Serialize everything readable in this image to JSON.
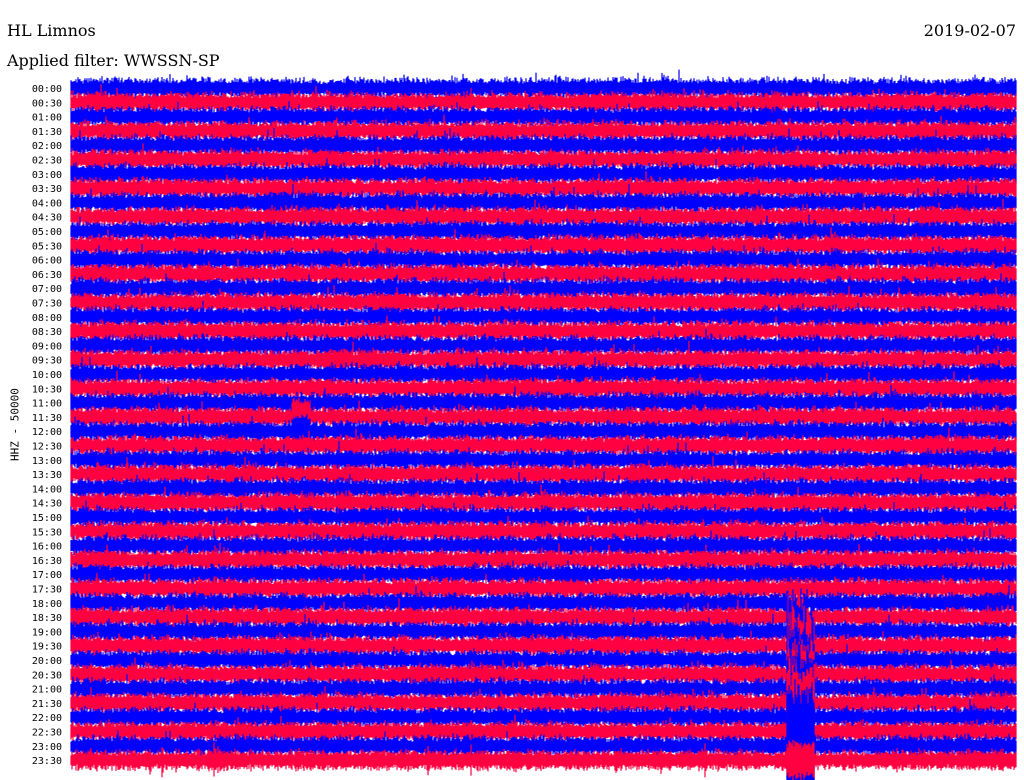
{
  "header": {
    "station": "HL Limnos",
    "date": "2019-02-07",
    "filter_label": "Applied filter:",
    "filter_value": "WWSSN-SP"
  },
  "chart_data": {
    "type": "line",
    "subtype": "helicorder",
    "title": "HL Limnos",
    "ylabel": "HHZ - 50000",
    "minutes_per_line": 30,
    "row_labels": [
      "00:00",
      "00:30",
      "01:00",
      "01:30",
      "02:00",
      "02:30",
      "03:00",
      "03:30",
      "04:00",
      "04:30",
      "05:00",
      "05:30",
      "06:00",
      "06:30",
      "07:00",
      "07:30",
      "08:00",
      "08:30",
      "09:00",
      "09:30",
      "10:00",
      "10:30",
      "11:00",
      "11:30",
      "12:00",
      "12:30",
      "13:00",
      "13:30",
      "14:00",
      "14:30",
      "15:00",
      "15:30",
      "16:00",
      "16:30",
      "17:00",
      "17:30",
      "18:00",
      "18:30",
      "19:00",
      "19:30",
      "20:00",
      "20:30",
      "21:00",
      "21:30",
      "22:00",
      "22:30",
      "23:00",
      "23:30"
    ],
    "colors": [
      "#0000ff",
      "#ff0040"
    ],
    "events": [
      {
        "row": "11:30",
        "minute": 7.0,
        "amplitude": 2.0,
        "duration_min": 0.6
      },
      {
        "row": "12:00",
        "minute": 7.0,
        "amplitude": 1.8,
        "duration_min": 0.6
      },
      {
        "row": "19:00",
        "minute": 22.9,
        "amplitude": 4,
        "duration_min": 0.3
      },
      {
        "row": "19:30",
        "minute": 22.7,
        "amplitude": 6,
        "duration_min": 0.6
      },
      {
        "row": "20:00",
        "minute": 22.7,
        "amplitude": 7,
        "duration_min": 0.9
      },
      {
        "row": "20:30",
        "minute": 22.7,
        "amplitude": 7,
        "duration_min": 0.9
      },
      {
        "row": "21:00",
        "minute": 22.7,
        "amplitude": 7,
        "duration_min": 0.9
      },
      {
        "row": "21:30",
        "minute": 22.7,
        "amplitude": 7,
        "duration_min": 0.9
      },
      {
        "row": "22:00",
        "minute": 22.7,
        "amplitude": 7,
        "duration_min": 0.9
      },
      {
        "row": "22:30",
        "minute": 22.7,
        "amplitude": 7,
        "duration_min": 0.9
      },
      {
        "row": "23:00",
        "minute": 22.7,
        "amplitude": 7,
        "duration_min": 0.9
      },
      {
        "row": "23:30",
        "minute": 22.7,
        "amplitude": 2,
        "duration_min": 0.9
      }
    ]
  }
}
